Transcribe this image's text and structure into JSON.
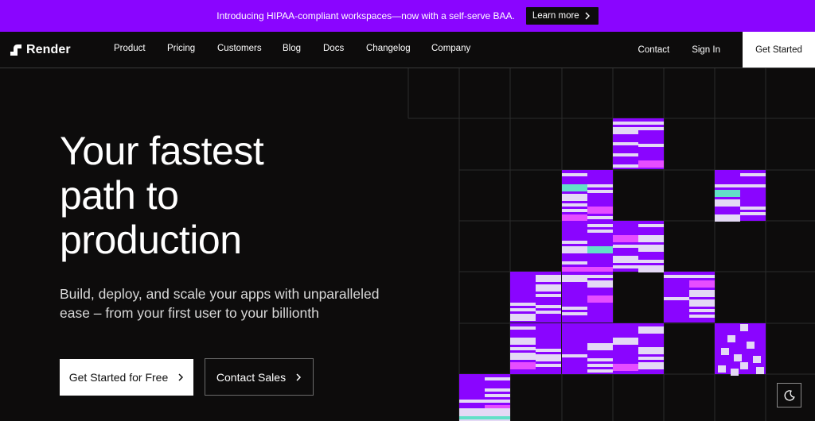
{
  "banner": {
    "text": "Introducing HIPAA-compliant workspaces—now with a self-serve BAA.",
    "cta": "Learn more"
  },
  "nav": {
    "logo": "Render",
    "links": [
      "Product",
      "Pricing",
      "Customers",
      "Blog",
      "Docs",
      "Changelog",
      "Company"
    ],
    "contact": "Contact",
    "sign_in": "Sign In",
    "get_started": "Get Started"
  },
  "hero": {
    "title_lines": [
      "Your fastest",
      "path to",
      "production"
    ],
    "subtitle_lines": [
      "Build, deploy, and scale your apps with unparalleled",
      "ease – from your first user to your billionth"
    ],
    "primary_cta": "Get Started for Free",
    "secondary_cta": "Contact Sales"
  },
  "icons": {
    "logo": "render-logo-icon",
    "chevron": "chevron-right-icon",
    "theme": "moon-icon"
  },
  "colors": {
    "brand_purple": "#8a05ff",
    "light_lilac": "#e4d9f5",
    "accent_magenta": "#e64dff",
    "accent_teal": "#62e0c8",
    "background": "#0d0c0c"
  }
}
